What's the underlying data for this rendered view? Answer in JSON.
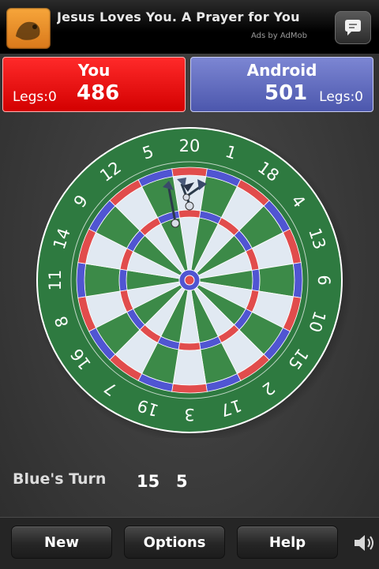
{
  "ad": {
    "title": "Jesus Loves You. A Prayer for You",
    "attribution": "Ads by AdMob"
  },
  "scoreboard": {
    "you": {
      "name": "You",
      "legs_label": "Legs:0",
      "score": "486"
    },
    "android": {
      "name": "Android",
      "legs_label": "Legs:0",
      "score": "501"
    }
  },
  "board": {
    "numbers": [
      "20",
      "1",
      "18",
      "4",
      "13",
      "6",
      "10",
      "15",
      "2",
      "17",
      "3",
      "19",
      "7",
      "16",
      "8",
      "11",
      "14",
      "9",
      "12",
      "5"
    ],
    "colors": {
      "outer": "#2e7a40",
      "green": "#3c8a48",
      "light": "#e1e9f2",
      "red": "#e14c4c",
      "blue": "#5055d2"
    }
  },
  "status": {
    "turn": "Blue's Turn",
    "throws": [
      "15",
      "5"
    ]
  },
  "toolbar": {
    "new": "New",
    "options": "Options",
    "help": "Help"
  },
  "icons": {
    "ad_icon": "lion-icon",
    "ad_action": "speech-bubble-icon",
    "sound": "speaker-icon"
  }
}
